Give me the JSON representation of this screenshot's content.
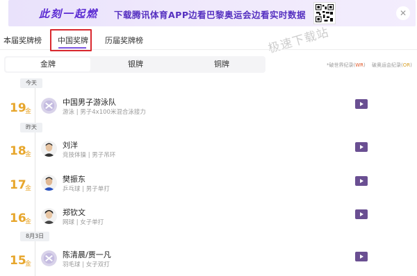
{
  "banner": {
    "slogan": "此刻一起燃",
    "text1": "下载腾讯体育APP",
    "text2": "边看巴黎奥运会边看实时数据",
    "close": "✕"
  },
  "watermark": "极速下载站",
  "tabs": [
    {
      "label": "本届奖牌榜"
    },
    {
      "label": "中国奖牌"
    },
    {
      "label": "历届奖牌榜"
    }
  ],
  "segments": [
    {
      "label": "金牌"
    },
    {
      "label": "银牌"
    },
    {
      "label": "铜牌"
    }
  ],
  "legend": {
    "wr_prefix": "*破世界纪录",
    "wr_badge": "WR",
    "or_prefix": "破奥运会纪录",
    "or_badge": "OR"
  },
  "dates": [
    "今天",
    "昨天",
    "8月3日"
  ],
  "unit": "金",
  "entries": [
    {
      "rank": "19",
      "name": "中国男子游泳队",
      "desc": "游泳 | 男子4x100米混合泳接力",
      "avatar": "team-logo"
    },
    {
      "rank": "18",
      "name": "刘洋",
      "desc": "竞技体操 | 男子吊环",
      "avatar": "athlete-photo"
    },
    {
      "rank": "17",
      "name": "樊振东",
      "desc": "乒乓球 | 男子单打",
      "avatar": "athlete-photo"
    },
    {
      "rank": "16",
      "name": "郑钦文",
      "desc": "网球 | 女子单打",
      "avatar": "athlete-photo"
    },
    {
      "rank": "15",
      "name": "陈清晨/贾一凡",
      "desc": "羽毛球 | 女子双打",
      "avatar": "team-logo"
    }
  ]
}
